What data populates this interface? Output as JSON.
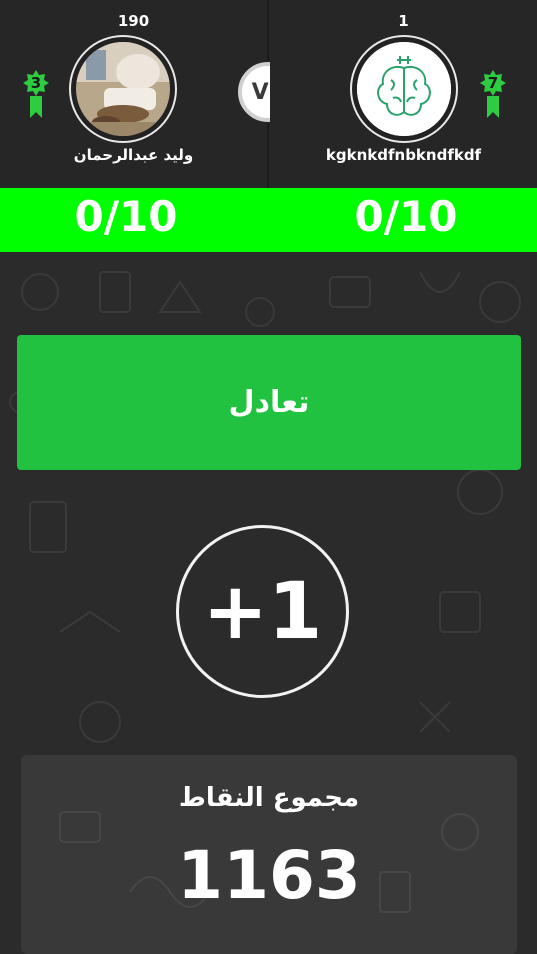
{
  "players": {
    "left": {
      "score": "190",
      "name": "وليد عبدالرحمان",
      "level": "3"
    },
    "right": {
      "score": "1",
      "name": "kgknkdfnbkndfkdf",
      "level": "7"
    }
  },
  "vs_label": "VS",
  "scorebar": {
    "left": "0/10",
    "right": "0/10"
  },
  "result_label": "تعادل",
  "points_gained": "+1",
  "total": {
    "label": "مجموع النقاط",
    "value": "1163"
  },
  "colors": {
    "accent_green": "#00ff00",
    "result_green": "#21c240",
    "badge_green": "#2ecc40",
    "background": "#2b2b2b"
  },
  "icons": {
    "left_avatar": "living-room-photo",
    "right_avatar": "brain-icon",
    "level_badge": "ribbon-star-badge"
  }
}
